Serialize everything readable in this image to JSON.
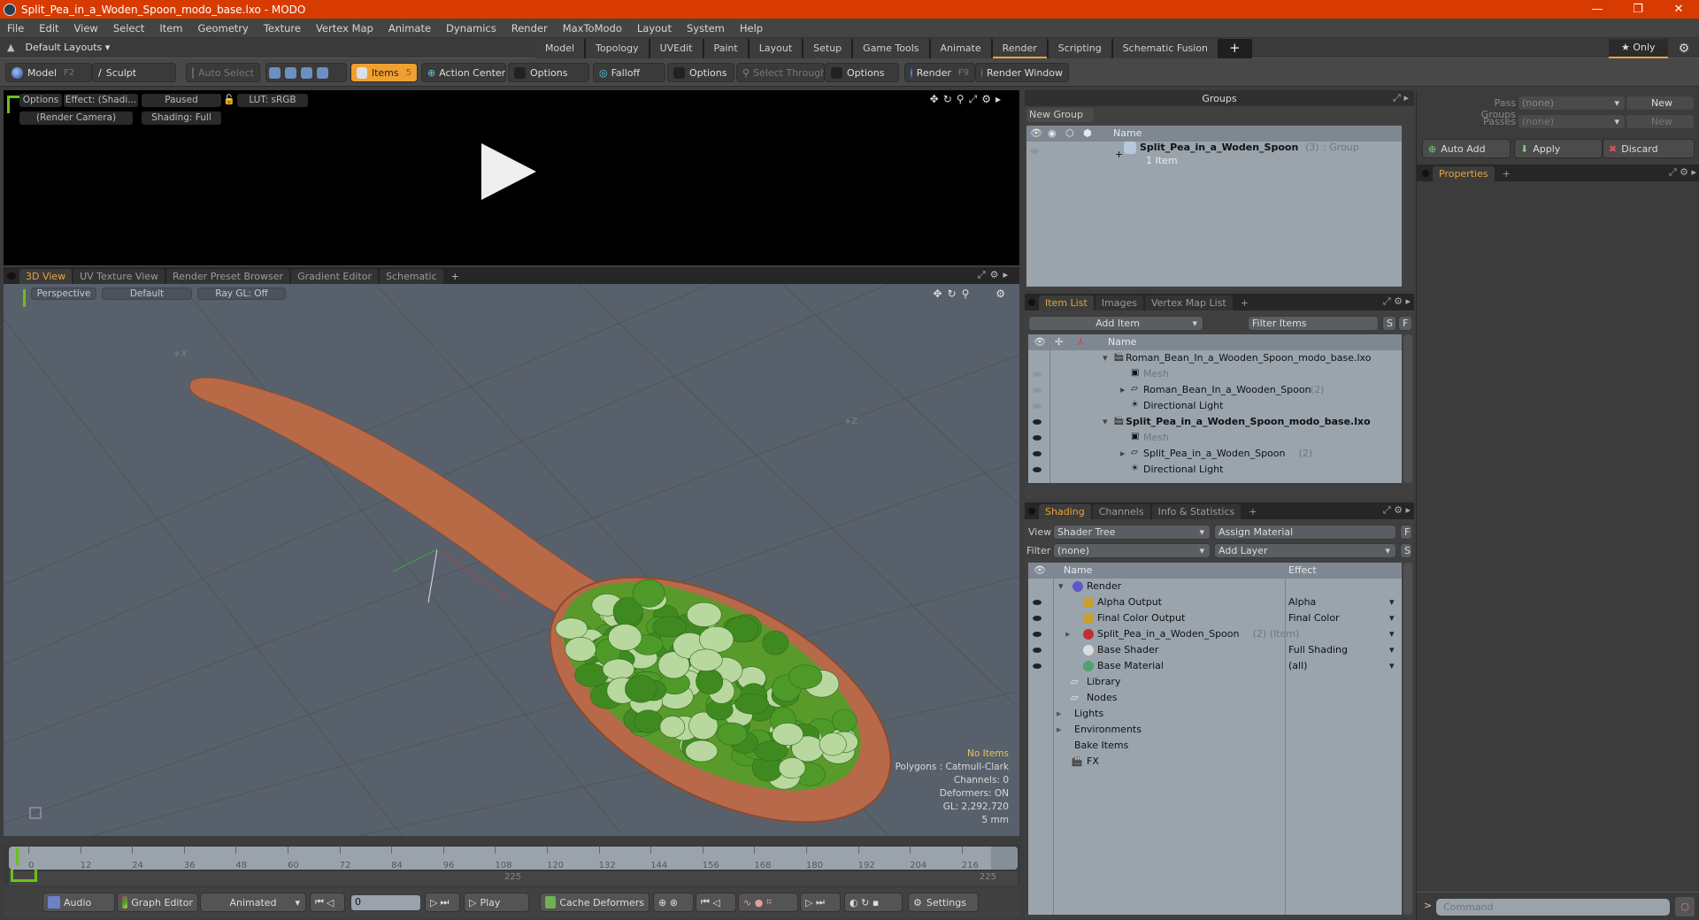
{
  "window": {
    "title": "Split_Pea_in_a_Woden_Spoon_modo_base.lxo - MODO",
    "controls": [
      "—",
      "❐",
      "✕"
    ]
  },
  "menu": [
    "File",
    "Edit",
    "View",
    "Select",
    "Item",
    "Geometry",
    "Texture",
    "Vertex Map",
    "Animate",
    "Dynamics",
    "Render",
    "MaxToModo",
    "Layout",
    "System",
    "Help"
  ],
  "layout": {
    "layouts_label": "Default Layouts ▾",
    "tabs": [
      "Model",
      "Topology",
      "UVEdit",
      "Paint",
      "Layout",
      "Setup",
      "Game Tools",
      "Animate",
      "Render",
      "Scripting",
      "Schematic Fusion"
    ],
    "active_tab": "Render",
    "add": "+",
    "only_label": "★ Only"
  },
  "toolbar": {
    "model": "Model",
    "model_key": "F2",
    "sculpt": "Sculpt",
    "auto_select": "Auto Select",
    "items": "Items",
    "items_key": "5",
    "action_center": "Action Center",
    "options1": "Options",
    "falloff": "Falloff",
    "options2": "Options",
    "select_through": "Select Through",
    "options3": "Options",
    "render": "Render",
    "render_key": "F9",
    "render_window": "Render Window"
  },
  "render_preview": {
    "options": "Options",
    "effect": "Effect: (Shadi...",
    "status": "Paused",
    "lut": "LUT: sRGB",
    "camera": "(Render Camera)",
    "shading": "Shading: Full"
  },
  "viewport_tabs": [
    "3D View",
    "UV Texture View",
    "Render Preset Browser",
    "Gradient Editor",
    "Schematic"
  ],
  "viewport": {
    "projection": "Perspective",
    "style": "Default",
    "raygl": "Ray GL: Off",
    "info": {
      "selection": "No Items",
      "polygons": "Polygons : Catmull-Clark",
      "channels": "Channels: 0",
      "deformers": "Deformers: ON",
      "gl": "GL: 2,292,720",
      "unit": "5 mm"
    }
  },
  "timeline": {
    "ticks": [
      "0",
      "12",
      "24",
      "36",
      "48",
      "60",
      "72",
      "84",
      "96",
      "108",
      "120",
      "132",
      "144",
      "156",
      "168",
      "180",
      "192",
      "204",
      "216"
    ],
    "start": "225",
    "end": "225"
  },
  "bottom": {
    "audio": "Audio",
    "graph_editor": "Graph Editor",
    "animated": "Animated",
    "frame": "0",
    "play": "Play",
    "cache_deformers": "Cache Deformers",
    "settings": "Settings"
  },
  "groups": {
    "title": "Groups",
    "new_group": "New Group",
    "col_name": "Name",
    "item": {
      "name": "Split_Pea_in_a_Woden_Spoon",
      "count": "(3)",
      "type": ": Group",
      "sub": "1 Item"
    }
  },
  "item_list": {
    "tabs": [
      "Item List",
      "Images",
      "Vertex Map List"
    ],
    "add_item": "Add Item",
    "filter": "Filter Items",
    "s": "S",
    "f": "F",
    "col_name": "Name",
    "rows": [
      {
        "name": "Roman_Bean_In_a_Wooden_Spoon_modo_base.lxo",
        "count": "",
        "indent": 0,
        "bold": false,
        "muted": false,
        "eye": "none"
      },
      {
        "name": "Mesh",
        "count": "",
        "indent": 1,
        "bold": false,
        "muted": true,
        "eye": "dim"
      },
      {
        "name": "Roman_Bean_In_a_Wooden_Spoon",
        "count": "(2)",
        "indent": 1,
        "bold": false,
        "muted": false,
        "eye": "dim"
      },
      {
        "name": "Directional Light",
        "count": "",
        "indent": 1,
        "bold": false,
        "muted": false,
        "eye": "dim"
      },
      {
        "name": "Split_Pea_in_a_Woden_Spoon_modo_base.lxo",
        "count": "",
        "indent": 0,
        "bold": true,
        "muted": false,
        "eye": "on"
      },
      {
        "name": "Mesh",
        "count": "",
        "indent": 1,
        "bold": false,
        "muted": true,
        "eye": "on"
      },
      {
        "name": "Split_Pea_in_a_Woden_Spoon",
        "count": "(2)",
        "indent": 1,
        "bold": false,
        "muted": false,
        "eye": "on"
      },
      {
        "name": "Directional Light",
        "count": "",
        "indent": 1,
        "bold": false,
        "muted": false,
        "eye": "on"
      }
    ]
  },
  "shading": {
    "tabs": [
      "Shading",
      "Channels",
      "Info & Statistics"
    ],
    "view_label": "View",
    "view_value": "Shader Tree",
    "assign_material": "Assign Material",
    "f": "F",
    "filter_label": "Filter",
    "filter_value": "(none)",
    "add_layer": "Add Layer",
    "s": "S",
    "col_name": "Name",
    "col_effect": "Effect",
    "rows": [
      {
        "name": "Render",
        "extra": "",
        "effect": "",
        "indent": 0,
        "eye": false,
        "icon": "#5a5ac8"
      },
      {
        "name": "Alpha Output",
        "extra": "",
        "effect": "Alpha",
        "indent": 1,
        "eye": true,
        "icon": "#c8a030"
      },
      {
        "name": "Final Color Output",
        "extra": "",
        "effect": "Final Color",
        "indent": 1,
        "eye": true,
        "icon": "#c8a030"
      },
      {
        "name": "Split_Pea_in_a_Woden_Spoon",
        "extra": "(2) (Item)",
        "effect": "",
        "indent": 1,
        "eye": true,
        "icon": "#c03030"
      },
      {
        "name": "Base Shader",
        "extra": "",
        "effect": "Full Shading",
        "indent": 1,
        "eye": true,
        "icon": "#dddddd"
      },
      {
        "name": "Base Material",
        "extra": "",
        "effect": "(all)",
        "indent": 1,
        "eye": true,
        "icon": "#50a070"
      },
      {
        "name": "Library",
        "extra": "",
        "effect": "",
        "indent": 0,
        "eye": false,
        "icon": "folder"
      },
      {
        "name": "Nodes",
        "extra": "",
        "effect": "",
        "indent": 0,
        "eye": false,
        "icon": "folder"
      },
      {
        "name": "Lights",
        "extra": "",
        "effect": "",
        "indent": -1,
        "eye": false,
        "icon": ""
      },
      {
        "name": "Environments",
        "extra": "",
        "effect": "",
        "indent": -1,
        "eye": false,
        "icon": ""
      },
      {
        "name": "Bake Items",
        "extra": "",
        "effect": "",
        "indent": -1,
        "eye": false,
        "icon": ""
      },
      {
        "name": "FX",
        "extra": "",
        "effect": "",
        "indent": 0,
        "eye": false,
        "icon": "clap"
      }
    ]
  },
  "passes": {
    "pass_groups_label": "Pass Groups",
    "pass_groups_value": "(none)",
    "new1": "New",
    "passes_label": "Passes",
    "passes_value": "(none)",
    "new2": "New",
    "auto_add": "Auto Add",
    "apply": "Apply",
    "discard": "Discard",
    "properties_tab": "Properties"
  },
  "command": {
    "prompt": ">",
    "placeholder": "Command"
  },
  "colors": {
    "accent": "#e8a33a",
    "titlebar": "#d83b01",
    "tree_bg": "#9aa4ad",
    "viewport_bg": "#58616b"
  }
}
